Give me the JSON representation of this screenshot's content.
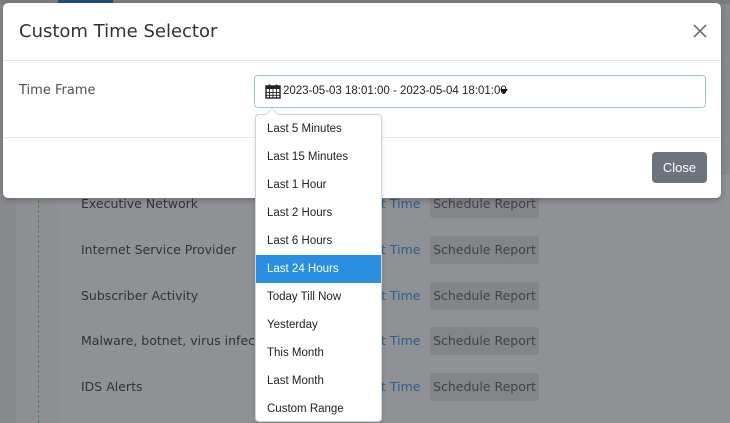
{
  "background": {
    "rows": [
      {
        "name": "Executive Network",
        "link": "t Time",
        "button": "Schedule Report"
      },
      {
        "name": "Internet Service Provider",
        "link": "t Time",
        "button": "Schedule Report"
      },
      {
        "name": "Subscriber Activity",
        "link": "t Time",
        "button": "Schedule Report"
      },
      {
        "name": "Malware, botnet, virus infection",
        "link": "t Time",
        "button": "Schedule Report"
      },
      {
        "name": "IDS Alerts",
        "link": "t Time",
        "button": "Schedule Report"
      }
    ]
  },
  "modal": {
    "title": "Custom Time Selector",
    "close_icon": "close-x-icon",
    "time_frame_label": "Time Frame",
    "date_range_value": "2023-05-03 18:01:00 - 2023-05-04 18:01:00",
    "calendar_icon": "calendar-icon",
    "caret_icon": "caret-down-icon",
    "close_button_label": "Close"
  },
  "dropdown": {
    "selected": "Last 24 Hours",
    "options": [
      "Last 5 Minutes",
      "Last 15 Minutes",
      "Last 1 Hour",
      "Last 2 Hours",
      "Last 6 Hours",
      "Last 24 Hours",
      "Today Till Now",
      "Yesterday",
      "This Month",
      "Last Month",
      "Custom Range"
    ]
  },
  "colors": {
    "accent": "#2a8fe0",
    "close_button": "#6c757d",
    "input_border": "#9fc3e8"
  }
}
